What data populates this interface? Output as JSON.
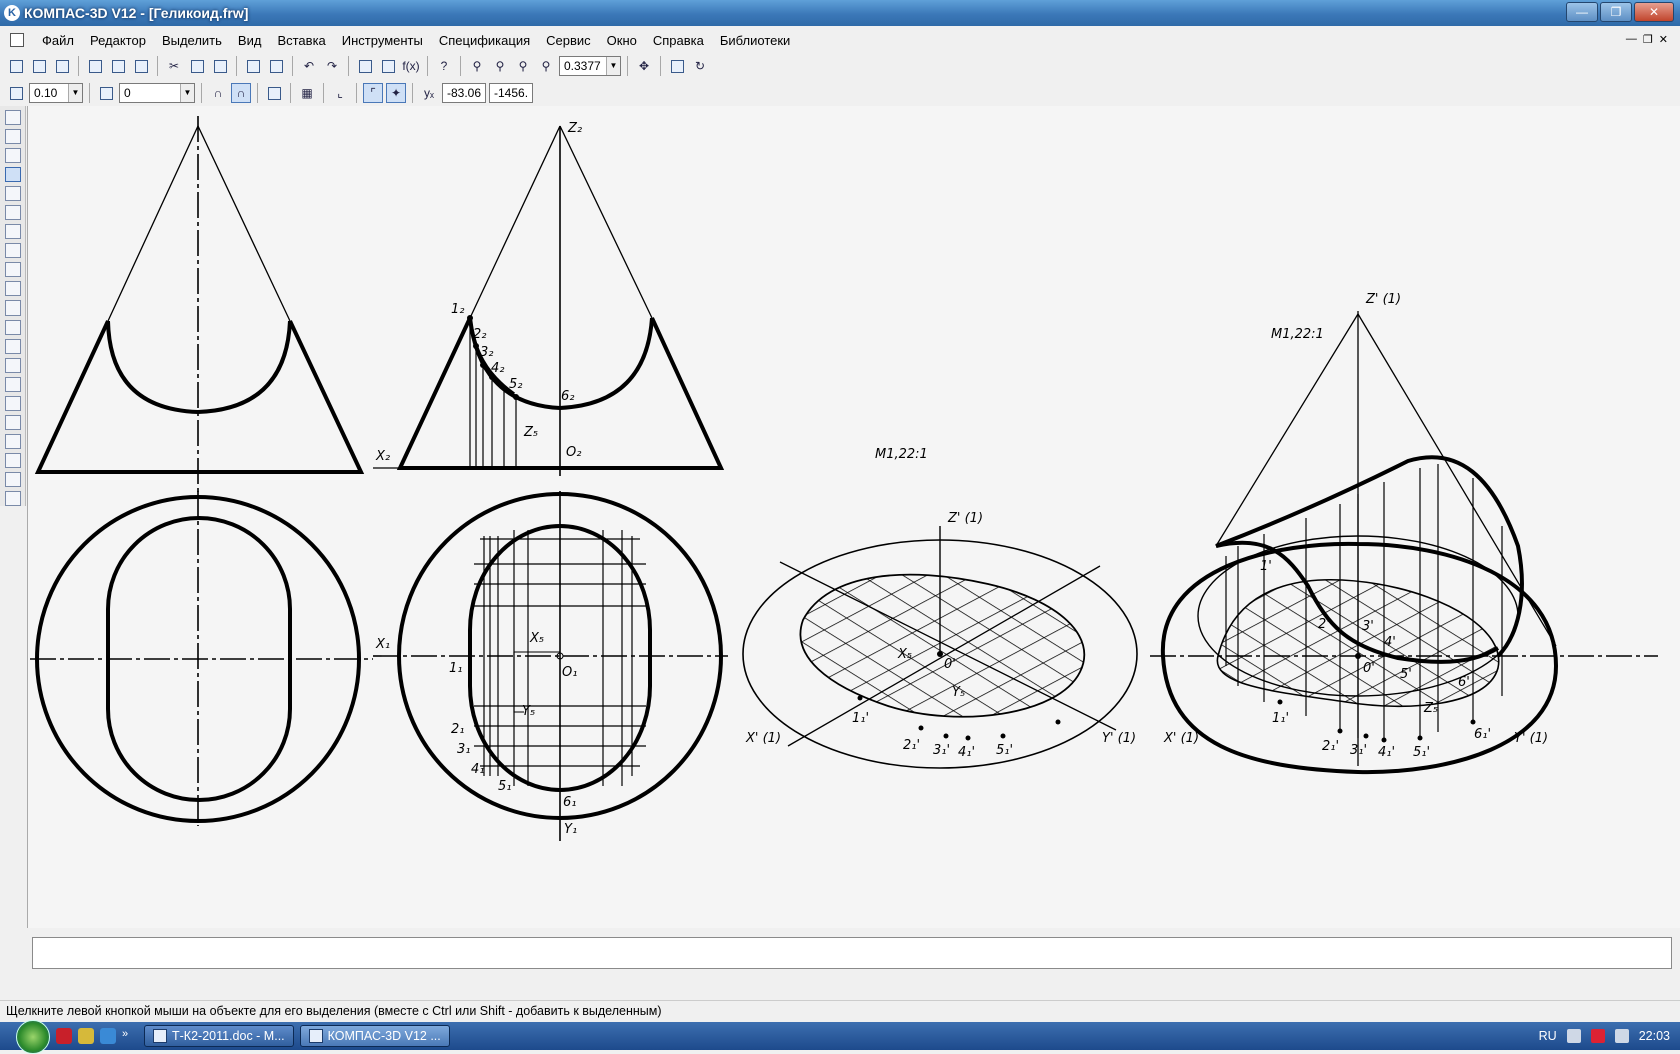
{
  "window": {
    "title": "КОМПАС-3D V12 - [Геликоид.frw]"
  },
  "menu": [
    "Файл",
    "Редактор",
    "Выделить",
    "Вид",
    "Вставка",
    "Инструменты",
    "Спецификация",
    "Сервис",
    "Окно",
    "Справка",
    "Библиотеки"
  ],
  "toolbar": {
    "zoom_value": "0.3377",
    "step_value": "0.10",
    "layer_value": "0",
    "cursor_x": "-83.06",
    "cursor_y": "-1456."
  },
  "drawing": {
    "labels": {
      "z2": "Z₂",
      "x2": "X₂",
      "o2": "O₂",
      "z5_front": "Z₅",
      "p1_2": "1₂",
      "p2_2": "2₂",
      "p3_2": "3₂",
      "p4_2": "4₂",
      "p5_2": "5₂",
      "p6_2": "6₂",
      "x1": "X₁",
      "o1": "O₁",
      "y1": "Y₁",
      "x5_top": "X₅",
      "y5_top": "Y₅",
      "p1_1": "1₁",
      "p2_1": "2₁",
      "p3_1": "3₁",
      "p4_1": "4₁",
      "p5_1": "5₁",
      "p6_1": "6₁",
      "scale_a": "M1,22:1",
      "scale_b": "M1,22:1",
      "za": "Z' (1)",
      "xa": "X' (1)",
      "ya": "Y' (1)",
      "oa": "0'",
      "x5a": "X₅",
      "y5a": "Y₅",
      "pa1": "1₁'",
      "pa2": "2₁'",
      "pa3": "3₁'",
      "pa4": "4₁'",
      "pa5": "5₁'",
      "zb": "Z' (1)",
      "xb": "X' (1)",
      "yb": "Y' (1)",
      "ob": "0'",
      "z5b": "Z₅",
      "pb1": "1₁'",
      "pb2": "2₁'",
      "pb3": "3₁'",
      "pb4": "4₁'",
      "pb5": "5₁'",
      "pb6": "6₁'",
      "qb1": "1'",
      "qb2": "2'",
      "qb3": "3'",
      "qb4": "4'",
      "qb5": "5'",
      "qb6": "6'"
    }
  },
  "status": {
    "hint": "Щелкните левой кнопкой мыши на объекте для его выделения (вместе с Ctrl или Shift - добавить к выделенным)"
  },
  "taskbar": {
    "tasks": [
      {
        "label": "Т-К2-2011.doc - М...",
        "icon": "word-icon"
      },
      {
        "label": "КОМПАС-3D V12 ...",
        "icon": "kompas-icon"
      }
    ],
    "lang": "RU",
    "clock": "22:03"
  },
  "colors": {
    "title_bar": "#3b78b8",
    "taskbar": "#1d4a8c",
    "canvas": "#f5f5f5"
  }
}
